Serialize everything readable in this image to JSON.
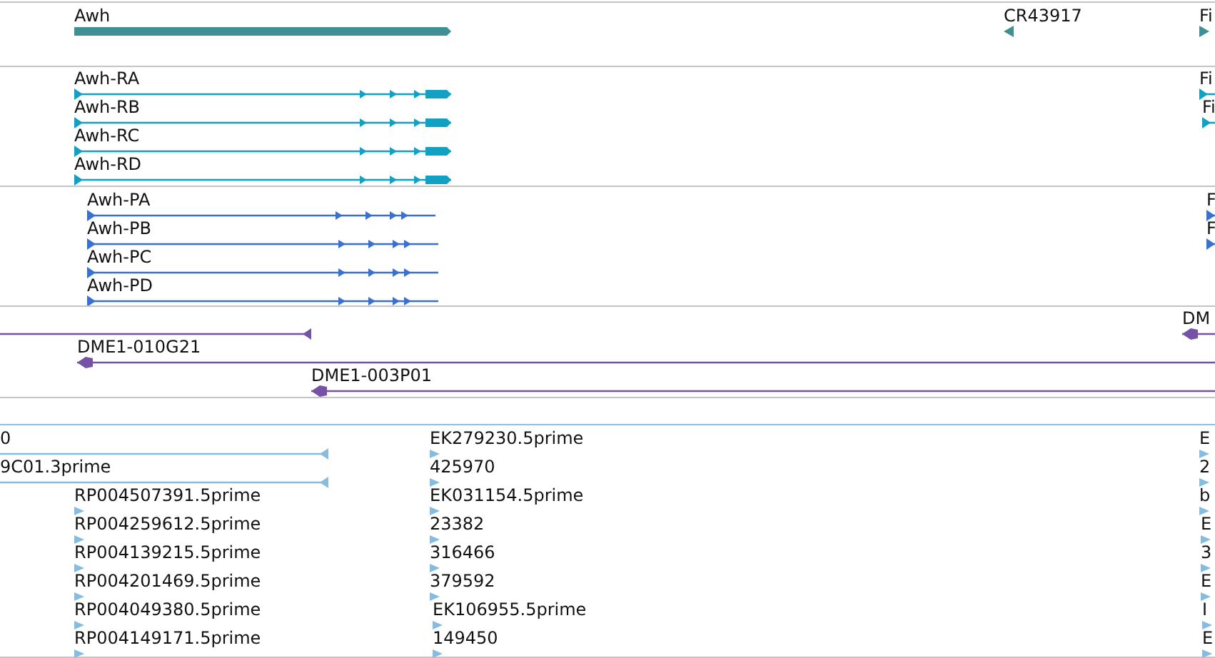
{
  "tracks": [
    {
      "kind": "gene",
      "features": [
        {
          "label": "Awh",
          "reverse": false
        },
        {
          "label": "CR43917",
          "reverse": true
        },
        {
          "label": "Fi",
          "reverse": false
        }
      ]
    },
    {
      "kind": "transcript",
      "features": [
        {
          "label": "Awh-RA",
          "reverse": false
        },
        {
          "label": "Awh-RB",
          "reverse": false
        },
        {
          "label": "Awh-RC",
          "reverse": false
        },
        {
          "label": "Awh-RD",
          "reverse": false
        },
        {
          "label": "Fi",
          "reverse": false
        },
        {
          "label": "Fi",
          "reverse": false
        }
      ]
    },
    {
      "kind": "protein",
      "features": [
        {
          "label": "Awh-PA",
          "reverse": false
        },
        {
          "label": "Awh-PB",
          "reverse": false
        },
        {
          "label": "Awh-PC",
          "reverse": false
        },
        {
          "label": "Awh-PD",
          "reverse": false
        },
        {
          "label": "F",
          "reverse": false
        },
        {
          "label": "F",
          "reverse": false
        }
      ]
    },
    {
      "kind": "clone",
      "features": [
        {
          "reverse": true
        },
        {
          "label": "DME1-010G21",
          "reverse": true
        },
        {
          "label": "DME1-003P01",
          "reverse": true
        },
        {
          "label": "DM",
          "reverse": true
        }
      ]
    },
    {
      "kind": "est",
      "features": [
        {
          "label": "0",
          "reverse": true
        },
        {
          "label": "9C01.3prime",
          "reverse": true
        },
        {
          "label": "RP004507391.5prime",
          "reverse": false
        },
        {
          "label": "RP004259612.5prime",
          "reverse": false
        },
        {
          "label": "RP004139215.5prime",
          "reverse": false
        },
        {
          "label": "RP004201469.5prime",
          "reverse": false
        },
        {
          "label": "RP004049380.5prime",
          "reverse": false
        },
        {
          "label": "RP004149171.5prime",
          "reverse": false
        },
        {
          "label": "EK279230.5prime",
          "reverse": false
        },
        {
          "label": "425970",
          "reverse": false
        },
        {
          "label": "EK031154.5prime",
          "reverse": false
        },
        {
          "label": "23382",
          "reverse": false
        },
        {
          "label": "316466",
          "reverse": false
        },
        {
          "label": "379592",
          "reverse": false
        },
        {
          "label": "EK106955.5prime",
          "reverse": false
        },
        {
          "label": "149450",
          "reverse": false
        },
        {
          "label": "E",
          "reverse": false
        },
        {
          "label": "2",
          "reverse": false
        },
        {
          "label": "b",
          "reverse": false
        },
        {
          "label": "E",
          "reverse": false
        },
        {
          "label": "3",
          "reverse": false
        },
        {
          "label": "E",
          "reverse": false
        },
        {
          "label": "I",
          "reverse": false
        },
        {
          "label": "E",
          "reverse": false
        }
      ]
    }
  ]
}
